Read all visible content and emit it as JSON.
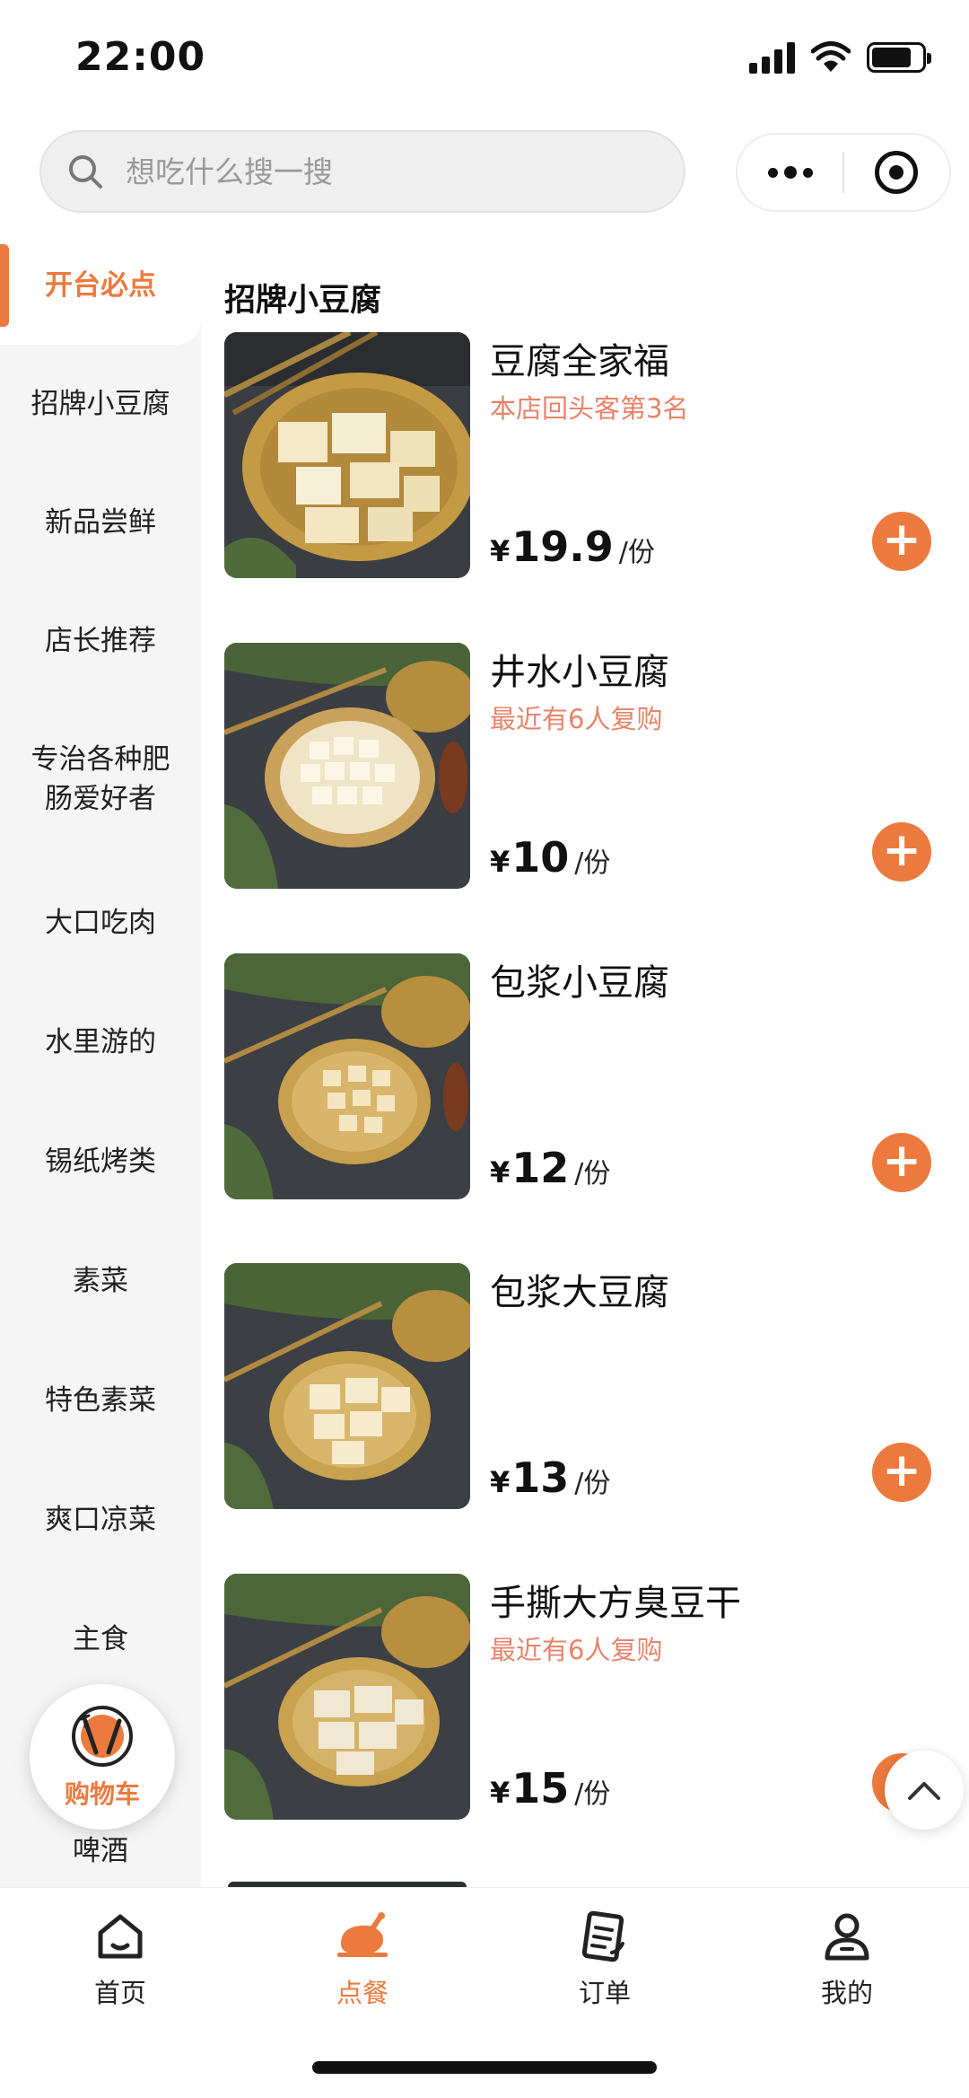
{
  "status": {
    "time": "22:00"
  },
  "search": {
    "placeholder": "想吃什么搜一搜"
  },
  "sidebar": {
    "items": [
      {
        "label": "开台必点",
        "active": true
      },
      {
        "label": "招牌小豆腐"
      },
      {
        "label": "新品尝鲜"
      },
      {
        "label": "店长推荐"
      },
      {
        "label": "专治各种肥肠爱好者"
      },
      {
        "label": "大口吃肉"
      },
      {
        "label": "水里游的"
      },
      {
        "label": "锡纸烤类"
      },
      {
        "label": "素菜"
      },
      {
        "label": "特色素菜"
      },
      {
        "label": "爽口凉菜"
      },
      {
        "label": "主食"
      },
      {
        "label": "啤酒"
      }
    ]
  },
  "main": {
    "section_title": "招牌小豆腐",
    "currency": "¥",
    "unit": "/份",
    "products": [
      {
        "name": "豆腐全家福",
        "tag": "本店回头客第3名",
        "price": "19.9"
      },
      {
        "name": "井水小豆腐",
        "tag": "最近有6人复购",
        "price": "10"
      },
      {
        "name": "包浆小豆腐",
        "tag": "",
        "price": "12"
      },
      {
        "name": "包浆大豆腐",
        "tag": "",
        "price": "13"
      },
      {
        "name": "手撕大方臭豆干",
        "tag": "最近有6人复购",
        "price": "15"
      }
    ]
  },
  "cart": {
    "label": "购物车"
  },
  "bottom_nav": {
    "items": [
      {
        "label": "首页"
      },
      {
        "label": "点餐",
        "active": true
      },
      {
        "label": "订单"
      },
      {
        "label": "我的"
      }
    ]
  },
  "colors": {
    "accent": "#ec7a3e",
    "tag": "#e8836a"
  }
}
